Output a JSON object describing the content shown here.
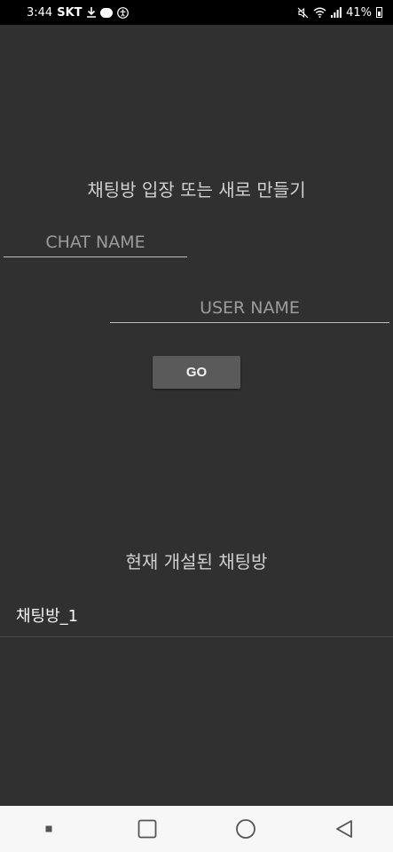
{
  "status_bar": {
    "time": "3:44",
    "carrier": "SKT",
    "battery_percent": "41%",
    "icons": [
      "download-icon",
      "talk-bubble-icon",
      "accessibility-icon",
      "mute-icon",
      "wifi-icon",
      "signal-icon",
      "battery-icon"
    ]
  },
  "create": {
    "title": "채팅방 입장 또는 새로 만들기",
    "chat_name_placeholder": "CHAT NAME",
    "user_name_placeholder": "USER NAME",
    "go_label": "GO"
  },
  "rooms": {
    "title": "현재 개설된 채팅방",
    "items": [
      {
        "label": "채팅방_1"
      }
    ]
  },
  "nav_bar": {
    "buttons": [
      "recents-dot",
      "overview-square",
      "home-circle",
      "back-triangle"
    ]
  }
}
